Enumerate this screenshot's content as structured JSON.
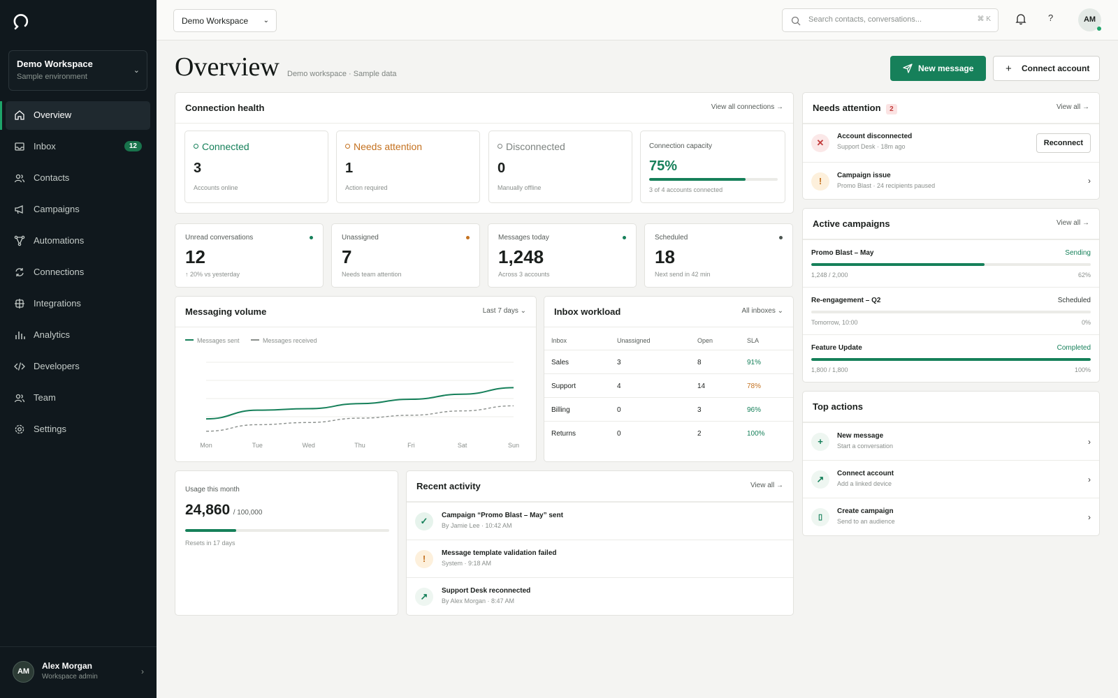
{
  "sidebar": {
    "workspace": {
      "name": "Demo Workspace",
      "env": "Sample environment"
    },
    "nav": [
      {
        "label": "Overview",
        "icon": "home-icon",
        "active": true
      },
      {
        "label": "Inbox",
        "icon": "inbox-icon",
        "badge": "12"
      },
      {
        "label": "Contacts",
        "icon": "users-icon"
      },
      {
        "label": "Campaigns",
        "icon": "megaphone-icon"
      },
      {
        "label": "Automations",
        "icon": "flow-icon"
      },
      {
        "label": "Connections",
        "icon": "sync-icon"
      },
      {
        "label": "Integrations",
        "icon": "grid-icon"
      },
      {
        "label": "Analytics",
        "icon": "bar-chart-icon"
      },
      {
        "label": "Developers",
        "icon": "code-icon"
      },
      {
        "label": "Team",
        "icon": "team-icon"
      },
      {
        "label": "Settings",
        "icon": "gear-icon"
      }
    ],
    "user": {
      "initials": "AM",
      "name": "Alex Morgan",
      "role": "Workspace admin"
    }
  },
  "topbar": {
    "workspace_select": "Demo Workspace",
    "search_placeholder": "Search contacts, conversations...",
    "search_shortcut": "⌘ K",
    "help": "?",
    "avatar": "AM"
  },
  "page": {
    "title": "Overview",
    "subtitle": "Demo workspace · Sample data",
    "new_message": "New message",
    "connect_account": "Connect account"
  },
  "connection_health": {
    "title": "Connection health",
    "link": "View all connections →",
    "tiles": [
      {
        "label": "Connected",
        "value": "3",
        "sub": "Accounts online",
        "color": "#16805a"
      },
      {
        "label": "Needs attention",
        "value": "1",
        "sub": "Action required",
        "color": "#c4711f"
      },
      {
        "label": "Disconnected",
        "value": "0",
        "sub": "Manually offline",
        "color": "#7d8380"
      }
    ],
    "capacity": {
      "label": "Connection capacity",
      "value": "75%",
      "fraction": 0.75,
      "sub": "3 of 4 accounts connected"
    }
  },
  "stats": [
    {
      "label": "Unread conversations",
      "value": "12",
      "sub": "↑ 20% vs yesterday",
      "dot": "#16805a"
    },
    {
      "label": "Unassigned",
      "value": "7",
      "sub": "Needs team attention",
      "dot": "#c4711f"
    },
    {
      "label": "Messages today",
      "value": "1,248",
      "sub": "Across 3 accounts",
      "dot": "#16805a"
    },
    {
      "label": "Scheduled",
      "value": "18",
      "sub": "Next send in 42 min",
      "dot": "#4b5450"
    }
  ],
  "volume": {
    "title": "Messaging volume",
    "range": "Last 7 days ⌄",
    "legend_sent": "Messages sent",
    "legend_received": "Messages received"
  },
  "chart_data": {
    "type": "line",
    "x": [
      "Mon",
      "Tue",
      "Wed",
      "Thu",
      "Fri",
      "Sat",
      "Sun"
    ],
    "series": [
      {
        "name": "Messages sent",
        "values": [
          22,
          34,
          36,
          43,
          49,
          56,
          65
        ],
        "color": "#16805a"
      },
      {
        "name": "Messages received",
        "values": [
          5,
          14,
          17,
          23,
          27,
          33,
          40
        ],
        "color": "#8a8f8c"
      }
    ],
    "ylim": [
      0,
      100
    ],
    "grid": true
  },
  "workload": {
    "title": "Inbox workload",
    "filter": "All inboxes ⌄",
    "headers": [
      "Inbox",
      "Unassigned",
      "Open",
      "SLA"
    ],
    "rows": [
      {
        "inbox": "Sales",
        "unassigned": "3",
        "open": "8",
        "sla": "91%",
        "sla_color": "#16805a"
      },
      {
        "inbox": "Support",
        "unassigned": "4",
        "open": "14",
        "sla": "78%",
        "sla_color": "#c4711f"
      },
      {
        "inbox": "Billing",
        "unassigned": "0",
        "open": "3",
        "sla": "96%",
        "sla_color": "#16805a"
      },
      {
        "inbox": "Returns",
        "unassigned": "0",
        "open": "2",
        "sla": "100%",
        "sla_color": "#16805a"
      }
    ]
  },
  "usage": {
    "label": "Usage this month",
    "value": "24,860",
    "total": "/ 100,000",
    "fraction": 0.2486,
    "sub": "Resets in 17 days"
  },
  "activity": {
    "title": "Recent activity",
    "link": "View all →",
    "items": [
      {
        "title": "Campaign “Promo Blast – May” sent",
        "sub": "By Jamie Lee · 10:42 AM",
        "icon": "check-icon",
        "glyph": "✓"
      },
      {
        "title": "Message template validation failed",
        "sub": "System · 9:18 AM",
        "icon": "warning-icon",
        "glyph": "!"
      },
      {
        "title": "Support Desk reconnected",
        "sub": "By Alex Morgan · 8:47 AM",
        "icon": "arrow-up-right-icon",
        "glyph": "↗"
      }
    ]
  },
  "attention": {
    "title": "Needs attention",
    "count": "2",
    "link": "View all →",
    "items": [
      {
        "title": "Account disconnected",
        "sub": "Support Desk · 18m ago",
        "action": "Reconnect",
        "glyph": "✕"
      },
      {
        "title": "Campaign issue",
        "sub": "Promo Blast · 24 recipients paused",
        "glyph": "!"
      }
    ]
  },
  "campaigns": {
    "title": "Active campaigns",
    "link": "View all →",
    "items": [
      {
        "name": "Promo Blast – May",
        "status": "Sending",
        "status_color": "#16805a",
        "progress": "1,248 / 2,000",
        "pct": "62%",
        "fraction": 0.62
      },
      {
        "name": "Re-engagement – Q2",
        "status": "Scheduled",
        "status_color": "#333a37",
        "progress": "Tomorrow, 10:00",
        "pct": "0%",
        "fraction": 0.0
      },
      {
        "name": "Feature Update",
        "status": "Completed",
        "status_color": "#16805a",
        "progress": "1,800 / 1,800",
        "pct": "100%",
        "fraction": 1.0
      }
    ]
  },
  "top_actions": {
    "title": "Top actions",
    "items": [
      {
        "title": "New message",
        "sub": "Start a conversation",
        "glyph": "+"
      },
      {
        "title": "Connect account",
        "sub": "Add a linked device",
        "glyph": "↗"
      },
      {
        "title": "Create campaign",
        "sub": "Send to an audience",
        "glyph": "▯"
      }
    ]
  }
}
